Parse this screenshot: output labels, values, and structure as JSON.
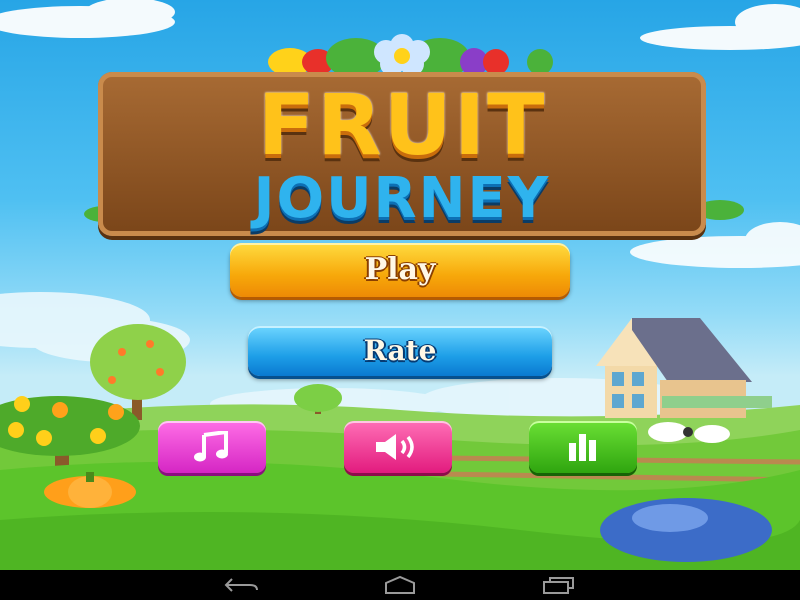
{
  "game": {
    "logo_line1": "FRUIT",
    "logo_line2": "JOURNEY"
  },
  "menu": {
    "play_label": "Play",
    "rate_label": "Rate"
  },
  "icon_buttons": [
    {
      "name": "music",
      "icon": "music-note-icon",
      "color": "#e23fd6"
    },
    {
      "name": "sound",
      "icon": "speaker-icon",
      "color": "#f0348f"
    },
    {
      "name": "stats",
      "icon": "bar-chart-icon",
      "color": "#3cb81a"
    }
  ],
  "nav": {
    "buttons": [
      "back-icon",
      "home-icon",
      "recent-apps-icon"
    ]
  },
  "colors": {
    "sky": "#4fc0f2",
    "play_button": "#f7a80a",
    "rate_button": "#1e9fe8",
    "grass": "#5cc42b"
  }
}
